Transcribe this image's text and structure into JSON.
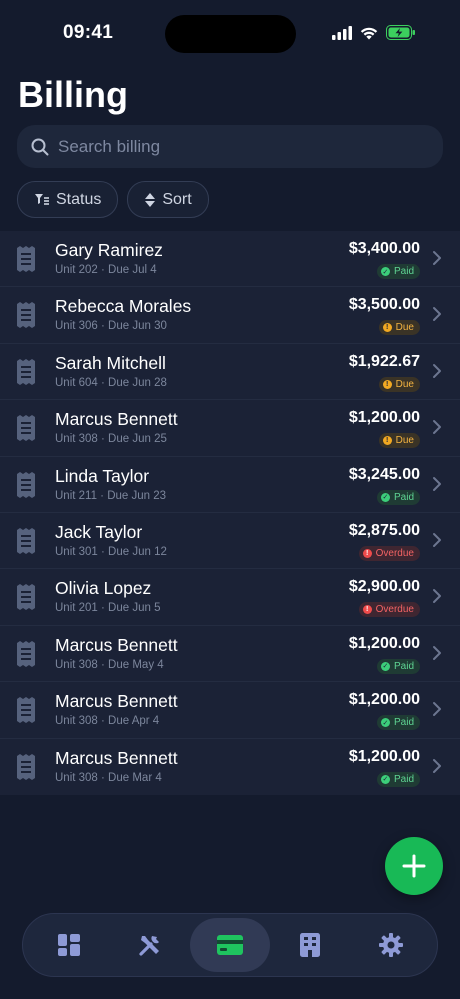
{
  "status_bar": {
    "time": "09:41"
  },
  "header": {
    "title": "Billing"
  },
  "search": {
    "placeholder": "Search billing"
  },
  "filters": {
    "status_label": "Status",
    "sort_label": "Sort"
  },
  "bills": [
    {
      "name": "Gary Ramirez",
      "meta": "Unit 202 · Due Jul 4",
      "amount": "$3,400.00",
      "status": "Paid"
    },
    {
      "name": "Rebecca Morales",
      "meta": "Unit 306 · Due Jun 30",
      "amount": "$3,500.00",
      "status": "Due"
    },
    {
      "name": "Sarah Mitchell",
      "meta": "Unit 604 · Due Jun 28",
      "amount": "$1,922.67",
      "status": "Due"
    },
    {
      "name": "Marcus Bennett",
      "meta": "Unit 308 · Due Jun 25",
      "amount": "$1,200.00",
      "status": "Due"
    },
    {
      "name": "Linda Taylor",
      "meta": "Unit 211 · Due Jun 23",
      "amount": "$3,245.00",
      "status": "Paid"
    },
    {
      "name": "Jack Taylor",
      "meta": "Unit 301 · Due Jun 12",
      "amount": "$2,875.00",
      "status": "Overdue"
    },
    {
      "name": "Olivia Lopez",
      "meta": "Unit 201 · Due Jun 5",
      "amount": "$2,900.00",
      "status": "Overdue"
    },
    {
      "name": "Marcus Bennett",
      "meta": "Unit 308 · Due May 4",
      "amount": "$1,200.00",
      "status": "Paid"
    },
    {
      "name": "Marcus Bennett",
      "meta": "Unit 308 · Due Apr 4",
      "amount": "$1,200.00",
      "status": "Paid"
    },
    {
      "name": "Marcus Bennett",
      "meta": "Unit 308 · Due Mar 4",
      "amount": "$1,200.00",
      "status": "Paid"
    }
  ],
  "tabs": [
    {
      "icon": "dashboard-icon",
      "active": false
    },
    {
      "icon": "tools-icon",
      "active": false
    },
    {
      "icon": "credit-card-icon",
      "active": true
    },
    {
      "icon": "building-icon",
      "active": false
    },
    {
      "icon": "gear-icon",
      "active": false
    }
  ],
  "colors": {
    "background": "#141b2d",
    "accent_green": "#18b956",
    "paid": "#3ccf7a",
    "due": "#f2a922",
    "overdue": "#ef4b4b"
  }
}
